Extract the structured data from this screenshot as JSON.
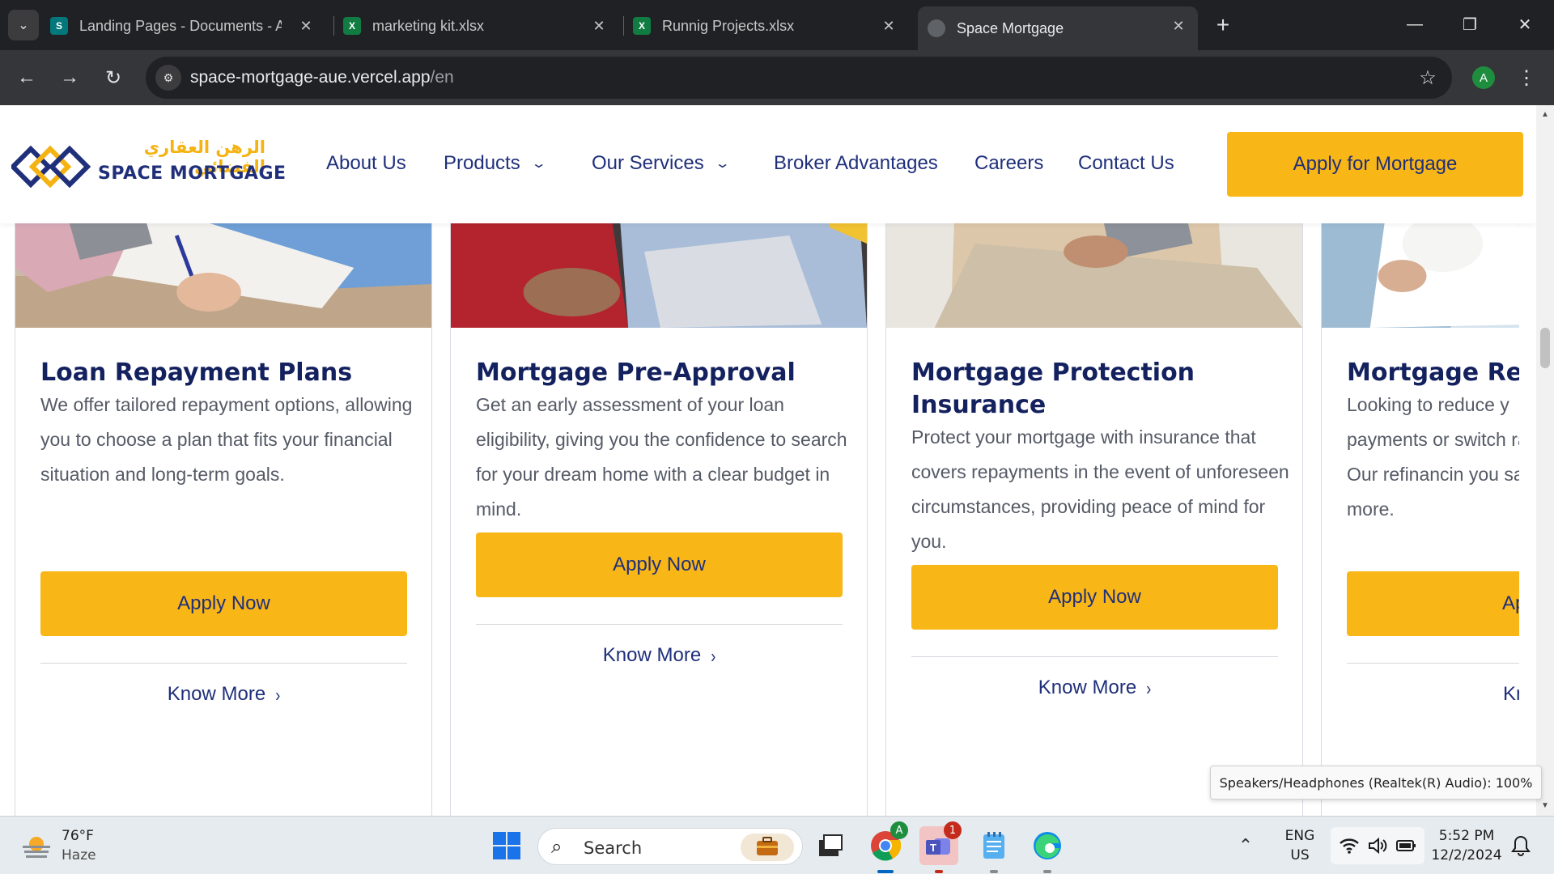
{
  "browser": {
    "tabs": [
      {
        "title": "Landing Pages - Documents - A",
        "favicon": "sharepoint-icon"
      },
      {
        "title": "marketing kit.xlsx",
        "favicon": "excel-icon"
      },
      {
        "title": "Runnig Projects.xlsx",
        "favicon": "excel-icon"
      },
      {
        "title": "Space Mortgage",
        "favicon": "globe-icon",
        "active": true
      }
    ],
    "url_host": "space-mortgage-aue.vercel.app",
    "url_path": "/en",
    "profile_initial": "A"
  },
  "site": {
    "logo_arabic": "الرهن العقاري الفضائي",
    "logo_english": "SPACE MORTGAGE",
    "nav": {
      "about": "About Us",
      "products": "Products",
      "services": "Our Services",
      "broker": "Broker Advantages",
      "careers": "Careers",
      "contact": "Contact Us"
    },
    "cta": "Apply for Mortgage",
    "colors": {
      "brand_yellow": "#f9b617",
      "brand_navy": "#1f2f7a"
    }
  },
  "cards": [
    {
      "title": "Loan Repayment Plans",
      "description": "We offer tailored repayment options, allowing you to choose a plan that fits your financial situation and long-term goals.",
      "apply": "Apply Now",
      "know_more": "Know More"
    },
    {
      "title": "Mortgage Pre-Approval",
      "description": "Get an early assessment of your loan eligibility, giving you the confidence to search for your dream home with a clear budget in mind.",
      "apply": "Apply Now",
      "know_more": "Know More"
    },
    {
      "title": "Mortgage Protection Insurance",
      "description": "Protect your mortgage with insurance that covers repayments in the event of unforeseen circumstances, providing peace of mind for you.",
      "apply": "Apply Now",
      "know_more": "Know More"
    },
    {
      "title": "Mortgage Refi",
      "description": "Looking to reduce y payments or switch rate? Our refinancin you save more.",
      "apply": "Appl",
      "know_more": "Know"
    }
  ],
  "tooltip": "Speakers/Headphones (Realtek(R) Audio): 100%",
  "taskbar": {
    "temperature": "76°F",
    "weather": "Haze",
    "search_placeholder": "Search",
    "lang_line1": "ENG",
    "lang_line2": "US",
    "time": "5:52 PM",
    "date": "12/2/2024",
    "chrome_badge": "A",
    "teams_badge": "1"
  }
}
